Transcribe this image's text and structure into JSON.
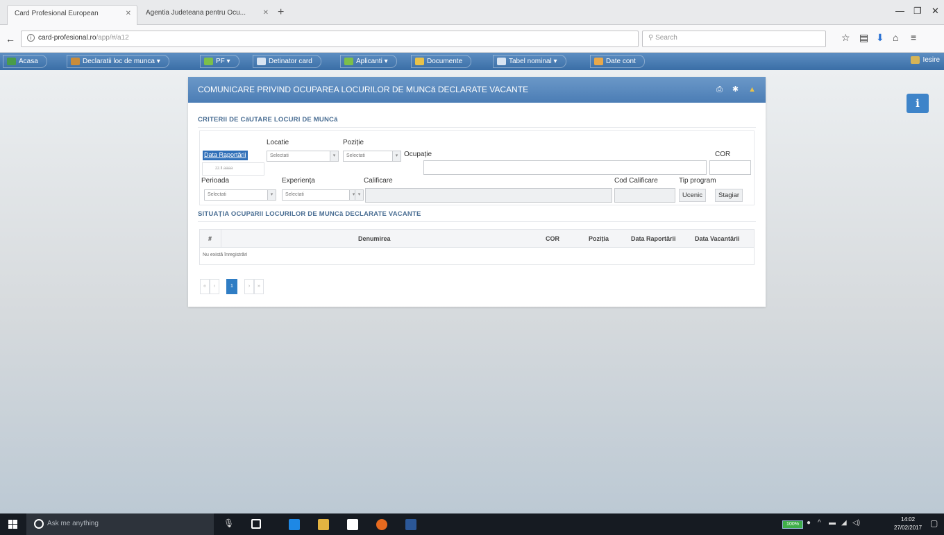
{
  "browser": {
    "tabs": [
      {
        "label": "Card Profesional European",
        "active": true
      },
      {
        "label": "Agentia Judeteana pentru Ocu...",
        "active": false
      }
    ],
    "url_host": "card-profesional.ro",
    "url_path": "/app/#/a12",
    "search_placeholder": "Search"
  },
  "menu": {
    "items": [
      {
        "label": "Acasa",
        "icon_color": "#4a9c4a"
      },
      {
        "label": "Declaratii loc de munca ▾",
        "icon_color": "#c98c3a"
      },
      {
        "label": "PF ▾",
        "icon_color": "#7cbf4a"
      },
      {
        "label": "Detinator card",
        "icon_color": "#d8e4f2"
      },
      {
        "label": "Aplicanti ▾",
        "icon_color": "#7cbf4a"
      },
      {
        "label": "Documente",
        "icon_color": "#e8c24a"
      },
      {
        "label": "Tabel nominal ▾",
        "icon_color": "#d8e4f2"
      },
      {
        "label": "Date cont",
        "icon_color": "#e8a84a"
      }
    ],
    "logout": "Iesire"
  },
  "panel": {
    "title": "COMUNICARE PRIVIND OCUPAREA LOCURILOR DE MUNCă DECLARATE VACANTE",
    "criteria_title": "CRITERII DE CăUTARE LOCURI DE MUNCă",
    "fields": {
      "data_raportarii": "Data Raportării",
      "data_hint": "zz.ll.aaaa",
      "locatie": "Locatie",
      "pozitie": "Poziție",
      "ocupatie": "Ocupație",
      "cor": "COR",
      "perioada": "Perioada",
      "experienta": "Experiența",
      "calificare": "Calificare",
      "cod_calificare": "Cod Calificare",
      "tip_program": "Tip program",
      "select_placeholder": "Selectati"
    },
    "buttons": {
      "ucenic": "Ucenic",
      "stagiar": "Stagiar"
    },
    "results_title": "SITUAȚIA OCUPăRII LOCURILOR DE MUNCă DECLARATE VACANTE",
    "table": {
      "headers": [
        "#",
        "Denumirea",
        "COR",
        "Poziția",
        "Data Raportării",
        "Data Vacantării"
      ],
      "empty_message": "Nu există înregistrări"
    },
    "pagination": {
      "first": "«",
      "prev": "‹",
      "current": "1",
      "next": "›",
      "last": "»"
    }
  },
  "taskbar": {
    "search_placeholder": "Ask me anything",
    "battery": "100%",
    "time": "14:02",
    "date": "27/02/2017"
  }
}
